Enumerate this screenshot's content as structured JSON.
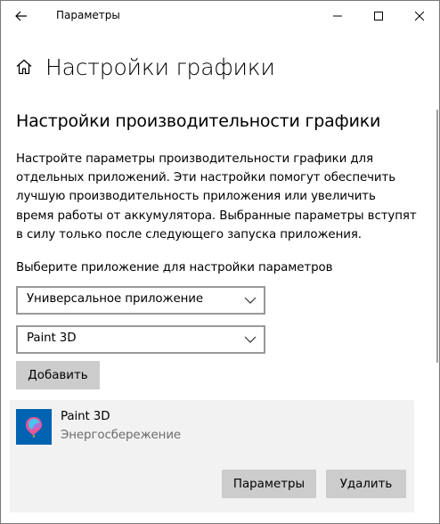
{
  "window": {
    "title": "Параметры"
  },
  "header": {
    "title": "Настройки графики"
  },
  "section": {
    "title": "Настройки производительности графики",
    "description": "Настройте параметры производительности графики для отдельных приложений. Эти настройки помогут обеспечить лучшую производительность приложения или увеличить время работы от аккумулятора. Выбранные параметры вступят в силу только после следующего запуска приложения."
  },
  "selector": {
    "label": "Выберите приложение для настройки параметров",
    "app_type": "Универсальное приложение",
    "app": "Paint 3D",
    "add_label": "Добавить"
  },
  "app_entry": {
    "name": "Paint 3D",
    "mode": "Энергосбережение",
    "options_label": "Параметры",
    "remove_label": "Удалить"
  },
  "icons": {
    "back": "back-arrow-icon",
    "minimize": "minimize-icon",
    "maximize": "maximize-icon",
    "close": "close-icon",
    "home": "home-icon",
    "dropdown": "chevron-down-icon",
    "app": "paint-3d-icon"
  },
  "colors": {
    "accent": "#0063b1",
    "button_bg": "#cccccc",
    "card_bg": "#f2f2f2",
    "secondary_text": "#6b6b6b"
  }
}
